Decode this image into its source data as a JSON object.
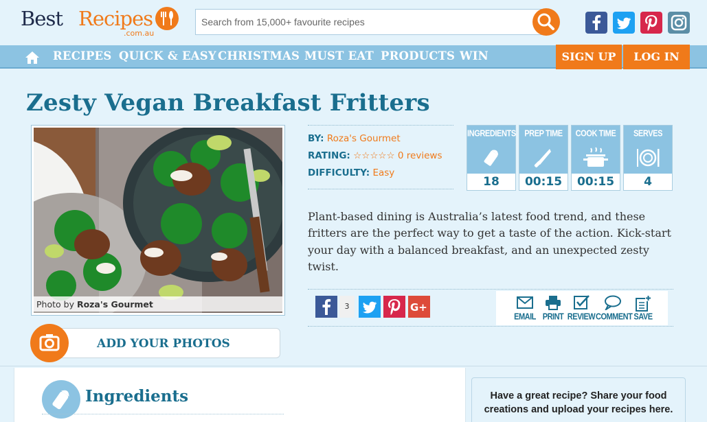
{
  "header": {
    "logo_word1": "Best",
    "logo_word2": "Recipes",
    "logo_sub": ".com.au",
    "search_placeholder": "Search from 15,000+ favourite recipes",
    "social": [
      "facebook-icon",
      "twitter-icon",
      "pinterest-icon",
      "instagram-icon"
    ]
  },
  "nav": {
    "items": [
      "RECIPES",
      "QUICK & EASY",
      "CHRISTMAS",
      "MUST EAT",
      "PRODUCTS",
      "WIN"
    ],
    "signup": "SIGN UP",
    "login": "LOG IN"
  },
  "recipe": {
    "title": "Zesty Vegan Breakfast Fritters",
    "photo_caption_prefix": "Photo by ",
    "photo_caption_author": "Roza's Gourmet",
    "add_photos": "ADD YOUR PHOTOS",
    "meta": {
      "by_label": "BY:",
      "by_value": "Roza's Gourmet",
      "rating_label": "RATING:",
      "rating_stars": "☆☆☆☆☆",
      "rating_reviews": "0 reviews",
      "difficulty_label": "DIFFICULTY:",
      "difficulty_value": "Easy"
    },
    "stats": [
      {
        "label": "INGREDIENTS",
        "value": "18",
        "icon": "salt-shaker-icon"
      },
      {
        "label": "PREP TIME",
        "value": "00:15",
        "icon": "knife-icon"
      },
      {
        "label": "COOK TIME",
        "value": "00:15",
        "icon": "pot-icon"
      },
      {
        "label": "SERVES",
        "value": "4",
        "icon": "plate-cutlery-icon"
      }
    ],
    "description": "Plant-based dining is Australia’s latest food trend, and these fritters are the perfect way to get a taste of the action. Kick-start your day with a balanced breakfast, and an unexpected zesty twist.",
    "share": {
      "fb_count": "3",
      "actions": [
        "EMAIL",
        "PRINT",
        "REVIEW",
        "COMMENT",
        "SAVE"
      ]
    }
  },
  "lower": {
    "ingredients_title": "Ingredients",
    "share_box_line1": "Have a great recipe? Share your food",
    "share_box_line2": "creations and upload your recipes here."
  },
  "colors": {
    "accent_orange": "#f07a1a",
    "nav_blue": "#8cc3e2",
    "title_teal": "#1a6e8e",
    "background": "#e4f3fb"
  }
}
